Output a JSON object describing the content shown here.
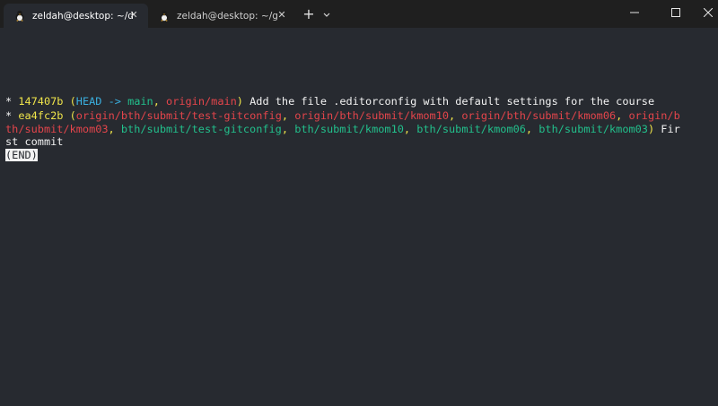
{
  "window": {
    "tabs": [
      {
        "title": "zeldah@desktop: ~/dbwebb-k",
        "active": true,
        "close_glyph": "✕"
      },
      {
        "title": "zeldah@desktop: ~/git/dbwebb",
        "active": false,
        "close_glyph": "✕"
      }
    ],
    "new_tab_glyph": "+",
    "icons": {
      "tab": "linux-tux-icon",
      "dropdown": "chevron-down-icon",
      "minimize": "minimize-icon",
      "maximize": "maximize-icon",
      "close": "close-icon"
    }
  },
  "terminal": {
    "colors": {
      "background": "#272a30",
      "hash": "#f0e54a",
      "head": "#3ab0e0",
      "local_branch": "#22c08c",
      "remote_branch": "#e4454b",
      "text": "#f2f2f2"
    },
    "commits": [
      {
        "marker": "* ",
        "hash": "147407b",
        "head": "HEAD ->",
        "branch_main": "main",
        "origin_main": "origin/main",
        "message": " Add the file .editorconfig with default settings for the course"
      },
      {
        "marker": "* ",
        "hash": "ea4fc2b",
        "remote_1": "origin/bth/submit/test-gitconfig",
        "remote_2": "origin/bth/submit/kmom10",
        "remote_3": "origin/bth/submit/kmom06",
        "remote_4a": "origin/b",
        "remote_4b": "th/submit/kmom03",
        "local_1": "bth/submit/test-gitconfig",
        "local_2": "bth/submit/kmom10",
        "local_3": "bth/submit/kmom06",
        "local_4": "bth/submit/kmom03",
        "message_a": " Fir",
        "message_b": "st commit"
      }
    ],
    "pager_end": "(END)"
  }
}
